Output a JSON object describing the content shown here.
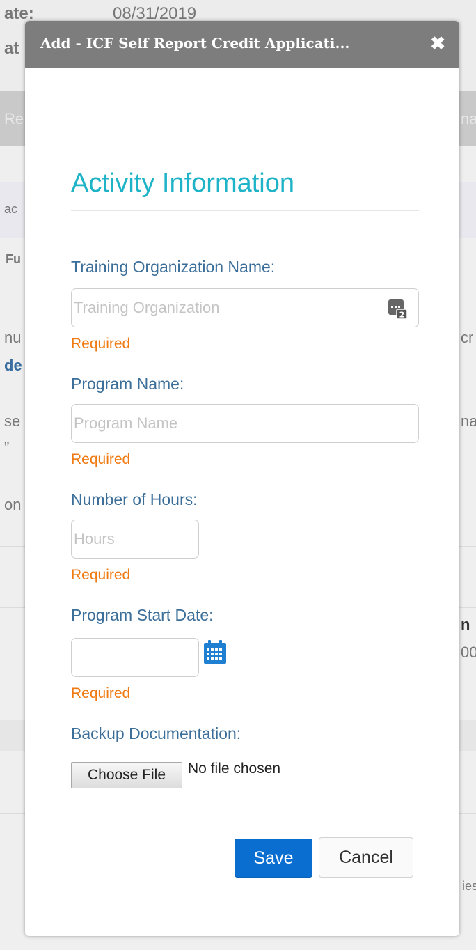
{
  "background": {
    "date_label": "ate:",
    "date_value": "08/31/2019",
    "status_label_fragment": "at",
    "table_header_left": "Re",
    "table_header_right": "na",
    "row_fragment_1": "ac",
    "row_fragment_2": "Fu",
    "row_fragment_3": "nu",
    "row_fragment_3_right": "cr",
    "row_fragment_4": "de",
    "row_fragment_5": "se",
    "row_fragment_5_right": "na",
    "row_fragment_6": "”",
    "row_fragment_7": "on",
    "row_fragment_8_right": "n",
    "row_fragment_9_right": "00",
    "row_fragment_10_right": "ies"
  },
  "modal": {
    "title": "Add - ICF Self Report Credit Applicati...",
    "close_symbol": "✖",
    "section_title": "Activity Information",
    "fields": {
      "training_org": {
        "label": "Training Organization Name:",
        "placeholder": "Training Organization",
        "value": "",
        "validation": "Required",
        "icon": "lookup-icon"
      },
      "program_name": {
        "label": "Program Name:",
        "placeholder": "Program Name",
        "value": "",
        "validation": "Required"
      },
      "hours": {
        "label": "Number of Hours:",
        "placeholder": "Hours",
        "value": "",
        "validation": "Required"
      },
      "start_date": {
        "label": "Program Start Date:",
        "placeholder": "",
        "value": "",
        "validation": "Required",
        "icon": "calendar-icon"
      },
      "backup_doc": {
        "label": "Backup Documentation:",
        "button_label": "Choose File",
        "status": "No file chosen"
      }
    },
    "buttons": {
      "save_label": "Save",
      "cancel_label": "Cancel"
    }
  },
  "colors": {
    "header_bg": "#7d7d7d",
    "section_title": "#1fb3c8",
    "label": "#3b6e99",
    "required": "#f07a12",
    "save_bg": "#0a6ed1",
    "icon_blue": "#1f7fd0"
  }
}
